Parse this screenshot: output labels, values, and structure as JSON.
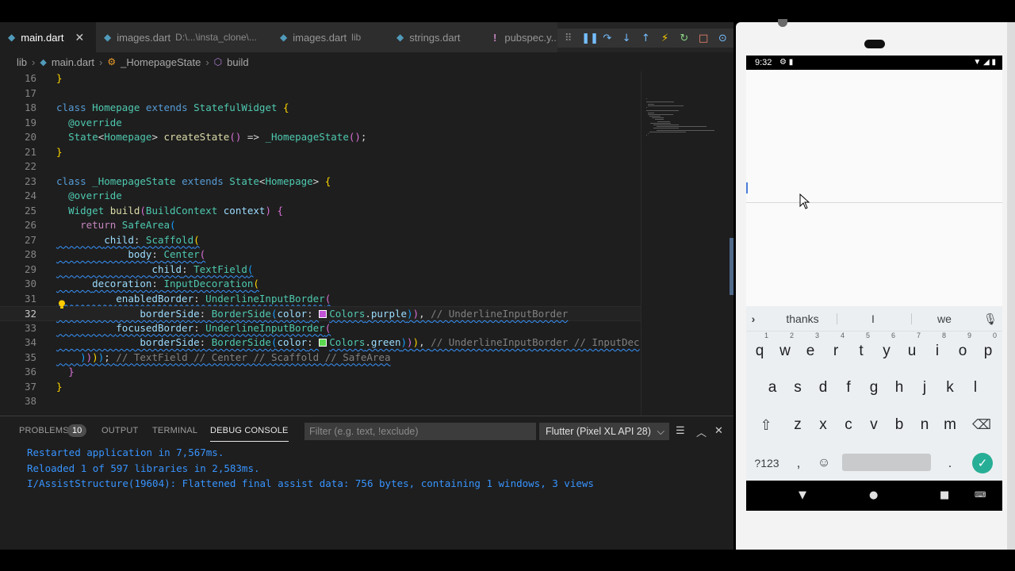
{
  "editor_tabs": [
    {
      "label": "main.dart",
      "desc": "",
      "active": true,
      "close": "✕"
    },
    {
      "label": "images.dart",
      "desc": "D:\\...\\insta_clone\\...",
      "active": false
    },
    {
      "label": "images.dart",
      "desc": "lib",
      "active": false
    },
    {
      "label": "strings.dart",
      "desc": "",
      "active": false
    },
    {
      "label": "pubspec.y...",
      "desc": "",
      "active": false
    }
  ],
  "breadcrumb": [
    "lib",
    "main.dart",
    "_HomepageState",
    "build"
  ],
  "code_lines": [
    {
      "n": "16",
      "t": "}"
    },
    {
      "n": "17",
      "t": ""
    },
    {
      "n": "18",
      "t": "class Homepage extends StatefulWidget {"
    },
    {
      "n": "19",
      "t": "  @override"
    },
    {
      "n": "20",
      "t": "  State<Homepage> createState() => _HomepageState();"
    },
    {
      "n": "21",
      "t": "}"
    },
    {
      "n": "22",
      "t": ""
    },
    {
      "n": "23",
      "t": "class _HomepageState extends State<Homepage> {"
    },
    {
      "n": "24",
      "t": "  @override"
    },
    {
      "n": "25",
      "t": "  Widget build(BuildContext context) {"
    },
    {
      "n": "26",
      "t": "    return SafeArea("
    },
    {
      "n": "27",
      "t": "        child: Scaffold("
    },
    {
      "n": "28",
      "t": "            body: Center("
    },
    {
      "n": "29",
      "t": "                child: TextField("
    },
    {
      "n": "30",
      "t": "      decoration: InputDecoration("
    },
    {
      "n": "31",
      "t": "          enabledBorder: UnderlineInputBorder("
    },
    {
      "n": "32",
      "t": "              borderSide: BorderSide(color: Colors.purple)), // UnderlineInputBorder"
    },
    {
      "n": "33",
      "t": "          focusedBorder: UnderlineInputBorder("
    },
    {
      "n": "34",
      "t": "              borderSide: BorderSide(color: Colors.green))), // UnderlineInputBorder // InputDec"
    },
    {
      "n": "35",
      "t": "    )))); // TextField // Center // Scaffold // SafeArea"
    },
    {
      "n": "36",
      "t": "  }"
    },
    {
      "n": "37",
      "t": "}"
    },
    {
      "n": "38",
      "t": ""
    }
  ],
  "panel": {
    "tabs": [
      "PROBLEMS",
      "OUTPUT",
      "TERMINAL",
      "DEBUG CONSOLE"
    ],
    "problems_count": "10",
    "filter_placeholder": "Filter (e.g. text, !exclude)",
    "device": "Flutter (Pixel XL API 28)",
    "console_lines": [
      "Restarted application in 7,567ms.",
      "Reloaded 1 of 597 libraries in 2,583ms.",
      "I/AssistStructure(19604): Flattened final assist data: 756 bytes, containing 1 windows, 3 views"
    ],
    "prompt": ">"
  },
  "phone": {
    "time": "9:32",
    "suggestions": [
      "thanks",
      "I",
      "we"
    ],
    "rows": [
      [
        [
          "q",
          "1"
        ],
        [
          "w",
          "2"
        ],
        [
          "e",
          "3"
        ],
        [
          "r",
          "4"
        ],
        [
          "t",
          "5"
        ],
        [
          "y",
          "6"
        ],
        [
          "u",
          "7"
        ],
        [
          "i",
          "8"
        ],
        [
          "o",
          "9"
        ],
        [
          "p",
          "0"
        ]
      ],
      [
        [
          "a",
          ""
        ],
        [
          "s",
          ""
        ],
        [
          "d",
          ""
        ],
        [
          "f",
          ""
        ],
        [
          "g",
          ""
        ],
        [
          "h",
          ""
        ],
        [
          "j",
          ""
        ],
        [
          "k",
          ""
        ],
        [
          "l",
          ""
        ]
      ],
      [
        [
          "z",
          ""
        ],
        [
          "x",
          ""
        ],
        [
          "c",
          ""
        ],
        [
          "v",
          ""
        ],
        [
          "b",
          ""
        ],
        [
          "n",
          ""
        ],
        [
          "m",
          ""
        ]
      ]
    ],
    "sym_key": "?123",
    "comma_key": ",",
    "period_key": "."
  },
  "colors": {
    "purple_swatch": "#c353d6",
    "green_swatch": "#5bd84f",
    "keyboard_enter": "#27ae96"
  }
}
